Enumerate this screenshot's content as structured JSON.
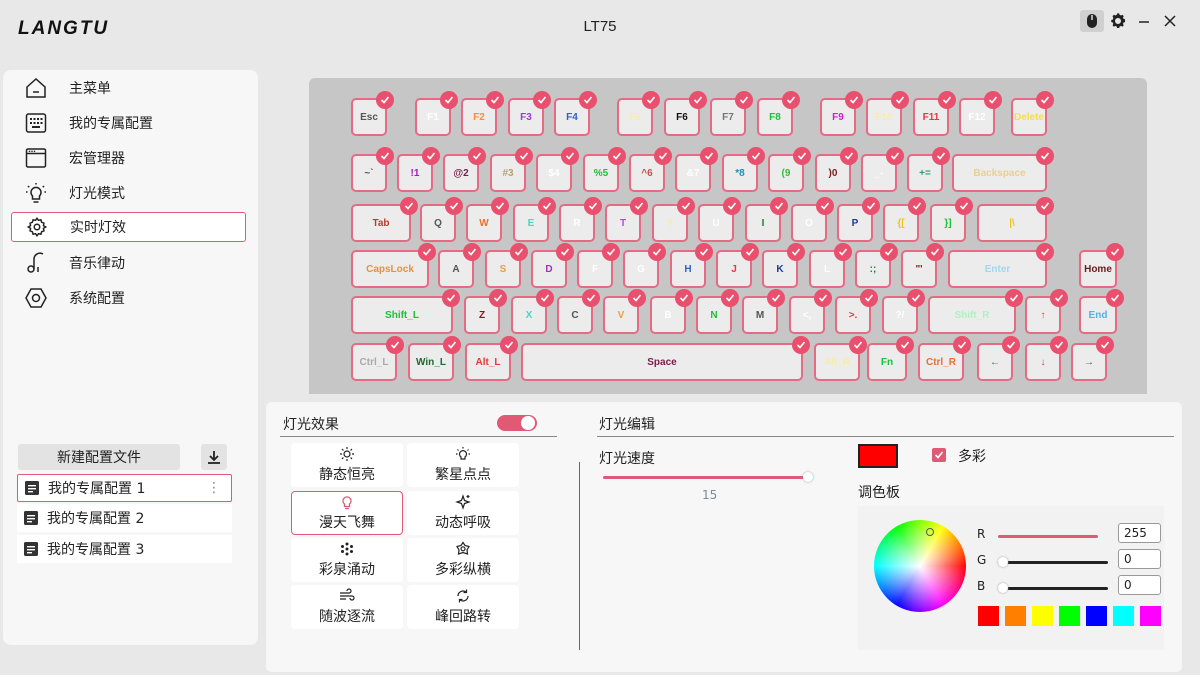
{
  "app": {
    "logo": "LANGTU",
    "title": "LT75"
  },
  "nav": [
    {
      "label": "主菜单",
      "icon": "home-icon"
    },
    {
      "label": "我的专属配置",
      "icon": "keyboard-icon"
    },
    {
      "label": "宏管理器",
      "icon": "window-icon"
    },
    {
      "label": "灯光模式",
      "icon": "bulb-icon"
    },
    {
      "label": "实时灯效",
      "icon": "gear-icon",
      "active": true
    },
    {
      "label": "音乐律动",
      "icon": "music-icon"
    },
    {
      "label": "系统配置",
      "icon": "hexagon-icon"
    }
  ],
  "profiles": {
    "new_label": "新建配置文件",
    "items": [
      "我的专属配置 1",
      "我的专属配置 2",
      "我的专属配置 3"
    ]
  },
  "keyboard": {
    "bg": "#c6c6c6",
    "check_color": "#e8506e",
    "keys": [
      [
        "Esc",
        "#555555"
      ],
      [
        "F1",
        "#ffffff"
      ],
      [
        "F2",
        "#ff8c3a"
      ],
      [
        "F3",
        "#9b3ad6"
      ],
      [
        "F4",
        "#2f62c8"
      ],
      [
        "F5",
        "#f5ecb0"
      ],
      [
        "F6",
        "#111111"
      ],
      [
        "F7",
        "#777777"
      ],
      [
        "F8",
        "#1fbf3a"
      ],
      [
        "F9",
        "#d41cd4"
      ],
      [
        "F10",
        "#f5ecb0"
      ],
      [
        "F11",
        "#e33a3a"
      ],
      [
        "F12",
        "#ffffff"
      ],
      [
        "Delete",
        "#f5e04a"
      ],
      [
        "~`",
        "#555555"
      ],
      [
        "!1",
        "#a31cc0"
      ],
      [
        "@2",
        "#7a1b4a"
      ],
      [
        "#3",
        "#b8a070"
      ],
      [
        "$4",
        "#ffffff"
      ],
      [
        "%5",
        "#1fbf3a"
      ],
      [
        "^6",
        "#c75050"
      ],
      [
        "&7",
        "#ffffff"
      ],
      [
        "*8",
        "#1a8fb0"
      ],
      [
        "(9",
        "#2fbf3a"
      ],
      [
        ")0",
        "#7a1b1b"
      ],
      [
        "_-",
        "#ffffff"
      ],
      [
        "+=",
        "#2aa070"
      ],
      [
        "Backspace",
        "#e8d090"
      ],
      [
        "Tab",
        "#c0392b"
      ],
      [
        "Q",
        "#555555"
      ],
      [
        "W",
        "#e8722a"
      ],
      [
        "E",
        "#55d0c0"
      ],
      [
        "R",
        "#ffffff"
      ],
      [
        "T",
        "#b050d0"
      ],
      [
        "Y",
        "#f5ecb0"
      ],
      [
        "U",
        "#ffffff"
      ],
      [
        "I",
        "#1e7a3a"
      ],
      [
        "O",
        "#ffffff"
      ],
      [
        "P",
        "#1b3a8a"
      ],
      [
        "{[",
        "#f0c419"
      ],
      [
        "}]",
        "#1fbf3a"
      ],
      [
        "|\\",
        "#f0c419"
      ],
      [
        "CapsLock",
        "#e89040"
      ],
      [
        "A",
        "#555555"
      ],
      [
        "S",
        "#e8a040"
      ],
      [
        "D",
        "#a030c0"
      ],
      [
        "F",
        "#ffffff"
      ],
      [
        "G",
        "#ffffff"
      ],
      [
        "H",
        "#2f62c8"
      ],
      [
        "J",
        "#e33a3a"
      ],
      [
        "K",
        "#1b3aa0"
      ],
      [
        "L",
        "#ffffff"
      ],
      [
        ":;",
        "#1e7a3a"
      ],
      [
        "\"'",
        "#7a1b1b"
      ],
      [
        "Enter",
        "#a0d8f0"
      ],
      [
        "Home",
        "#6b2020"
      ],
      [
        "Shift_L",
        "#1fbf3a"
      ],
      [
        "Z",
        "#7a1b1b"
      ],
      [
        "X",
        "#55d0c0"
      ],
      [
        "C",
        "#555555"
      ],
      [
        "V",
        "#e8a040"
      ],
      [
        "B",
        "#ffffff"
      ],
      [
        "N",
        "#1fbf3a"
      ],
      [
        "M",
        "#555555"
      ],
      [
        "<,",
        "#ffffff"
      ],
      [
        ">.",
        "#e33a3a"
      ],
      [
        "?/",
        "#ffffff"
      ],
      [
        "Shift_R",
        "#b0f0c0"
      ],
      [
        "↑",
        "#e33a3a"
      ],
      [
        "End",
        "#5ab0e0"
      ],
      [
        "Ctrl_L",
        "#aaaaaa"
      ],
      [
        "Win_L",
        "#1e6a2a"
      ],
      [
        "Alt_L",
        "#e33a3a"
      ],
      [
        "Space",
        "#7a1b4a"
      ],
      [
        "Alt_R",
        "#f5ecb0"
      ],
      [
        "Fn",
        "#1fbf3a"
      ],
      [
        "Ctrl_R",
        "#e8722a"
      ],
      [
        "←",
        "#2f62c8"
      ],
      [
        "↓",
        "#e33a3a"
      ],
      [
        "→",
        "#555555"
      ]
    ]
  },
  "effects": {
    "title": "灯光效果",
    "toggle_on": true,
    "items": [
      {
        "label": "静态恒亮",
        "icon": "sun-icon"
      },
      {
        "label": "繁星点点",
        "icon": "bulb-rays-icon"
      },
      {
        "label": "漫天飞舞",
        "icon": "bulb-icon",
        "active": true
      },
      {
        "label": "动态呼吸",
        "icon": "sparkle-icon"
      },
      {
        "label": "彩泉涌动",
        "icon": "snowflake-icon"
      },
      {
        "label": "多彩纵横",
        "icon": "flower-icon"
      },
      {
        "label": "随波逐流",
        "icon": "wind-icon"
      },
      {
        "label": "峰回路转",
        "icon": "cycle-icon"
      }
    ]
  },
  "editor": {
    "title": "灯光编辑",
    "speed_label": "灯光速度",
    "speed_value": "15",
    "speed_max": 15,
    "color_hex": "#ff0000",
    "multicolor_label": "多彩",
    "multicolor_checked": true,
    "palette_title": "调色板",
    "rgb": [
      {
        "label": "R",
        "value": "255"
      },
      {
        "label": "G",
        "value": "0"
      },
      {
        "label": "B",
        "value": "0"
      }
    ],
    "presets": [
      "#ff0000",
      "#ff8000",
      "#ffff00",
      "#00ff00",
      "#0000ff",
      "#00ffff",
      "#ff00ff"
    ],
    "accent": "#e05a76"
  }
}
